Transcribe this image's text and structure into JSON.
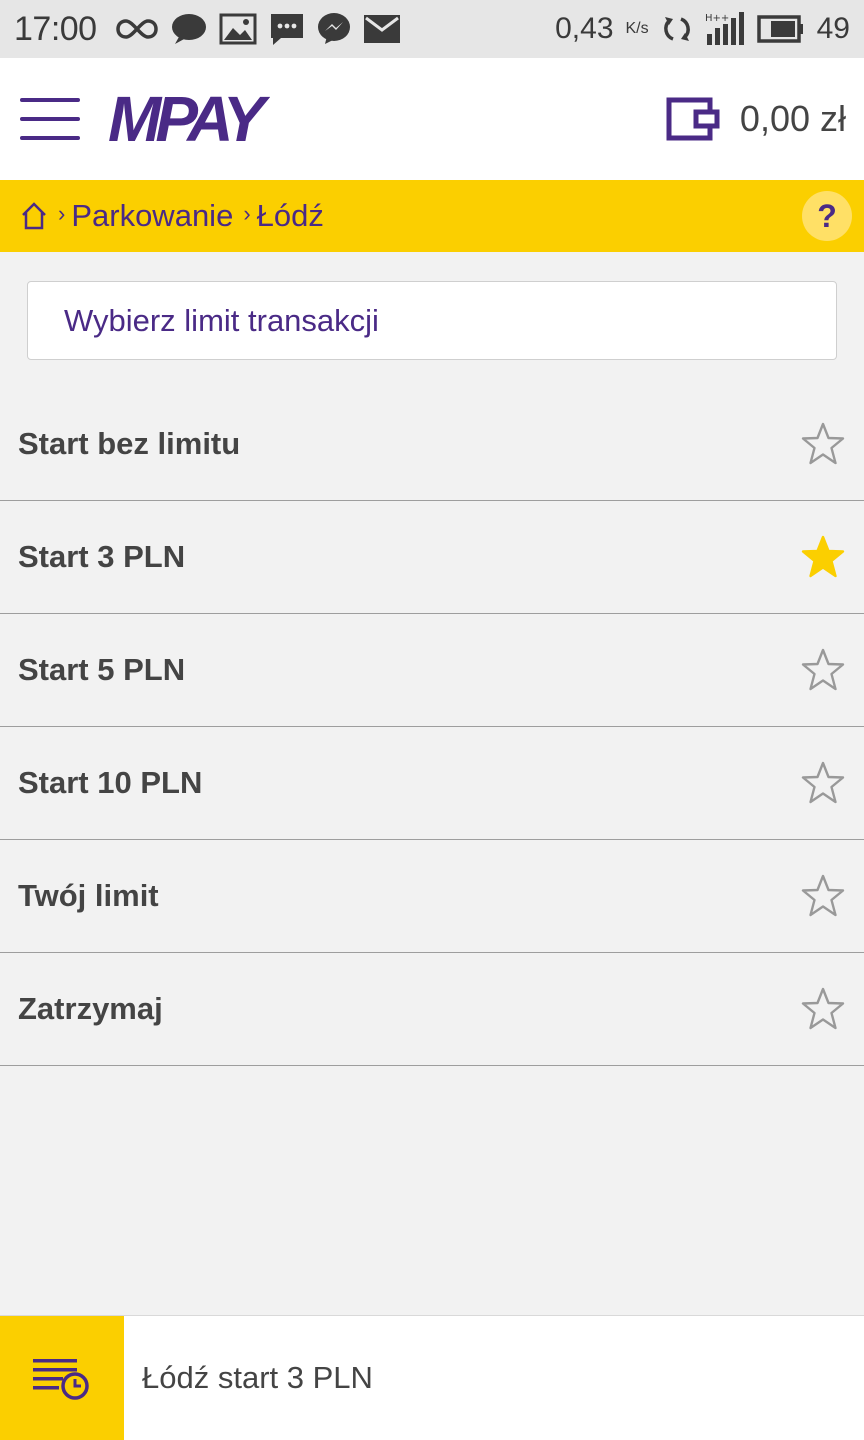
{
  "status_bar": {
    "time": "17:00",
    "speed": "0,43",
    "speed_unit": "K/s",
    "battery": "49"
  },
  "header": {
    "logo_text": "MPAY",
    "balance": "0,00 zł"
  },
  "breadcrumb": {
    "items": [
      "Parkowanie",
      "Łódź"
    ],
    "help_label": "?"
  },
  "select": {
    "label": "Wybierz limit transakcji"
  },
  "list": {
    "items": [
      {
        "label": "Start bez limitu",
        "favorite": false
      },
      {
        "label": "Start 3 PLN",
        "favorite": true
      },
      {
        "label": "Start 5 PLN",
        "favorite": false
      },
      {
        "label": "Start 10 PLN",
        "favorite": false
      },
      {
        "label": "Twój limit",
        "favorite": false
      },
      {
        "label": "Zatrzymaj",
        "favorite": false
      }
    ]
  },
  "bottom_bar": {
    "text": "Łódź start 3 PLN"
  },
  "colors": {
    "brand_purple": "#4a2a86",
    "brand_yellow": "#fbcf00",
    "star_active": "#fbcf00",
    "star_inactive": "#999999"
  }
}
